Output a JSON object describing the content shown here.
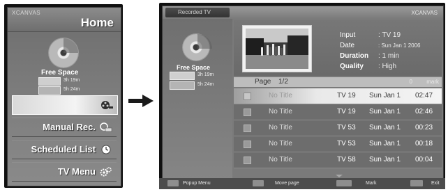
{
  "home": {
    "brand": "XCANVAS",
    "title": "Home",
    "free_space_label": "Free Space",
    "space_rows": [
      {
        "value": "3h  19m"
      },
      {
        "value": "5h  24m"
      }
    ],
    "menu": [
      {
        "label": "",
        "icon": "film-reel-icon",
        "selected": true
      },
      {
        "label": "Manual Rec.",
        "icon": "manual-rec-icon",
        "selected": false
      },
      {
        "label": "Scheduled List",
        "icon": "clock-icon",
        "selected": false
      },
      {
        "label": "TV Menu",
        "icon": "gears-icon",
        "selected": false
      }
    ]
  },
  "recorded_tv": {
    "title": "Recorded TV",
    "brand": "XCANVAS",
    "free_space_label": "Free Space",
    "space_rows": [
      {
        "value": "3h  19m"
      },
      {
        "value": "5h  24m"
      }
    ],
    "info": {
      "input_label": "Input",
      "input_value": ": TV 19",
      "date_label": "Date",
      "date_value": ": Sun Jan 1 2006",
      "duration_label": "Duration",
      "duration_value": ": 1 min",
      "quality_label": "Quality",
      "quality_value": ": High"
    },
    "page": {
      "label": "Page",
      "value": "1/2",
      "mark_count": "0",
      "mark_label": "mark"
    },
    "rows": [
      {
        "title": "No Title",
        "channel": "TV 19",
        "date": "Sun Jan 1",
        "duration": "02:47",
        "selected": true
      },
      {
        "title": "No Title",
        "channel": "TV 19",
        "date": "Sun Jan 1",
        "duration": "02:46",
        "selected": false
      },
      {
        "title": "No Title",
        "channel": "TV 53",
        "date": "Sun Jan 1",
        "duration": "00:23",
        "selected": false
      },
      {
        "title": "No Title",
        "channel": "TV 53",
        "date": "Sun Jan 1",
        "duration": "00:18",
        "selected": false
      },
      {
        "title": "No Title",
        "channel": "TV 58",
        "date": "Sun Jan 1",
        "duration": "00:04",
        "selected": false
      }
    ],
    "footer": [
      {
        "label": "Popup Menu"
      },
      {
        "label": "Move page"
      },
      {
        "label": "Mark"
      },
      {
        "label": "Exit"
      }
    ]
  },
  "colors": {
    "panel_gray": "#7d7d7d",
    "selection_light": "#f4f4f4",
    "frame_black": "#101010"
  }
}
